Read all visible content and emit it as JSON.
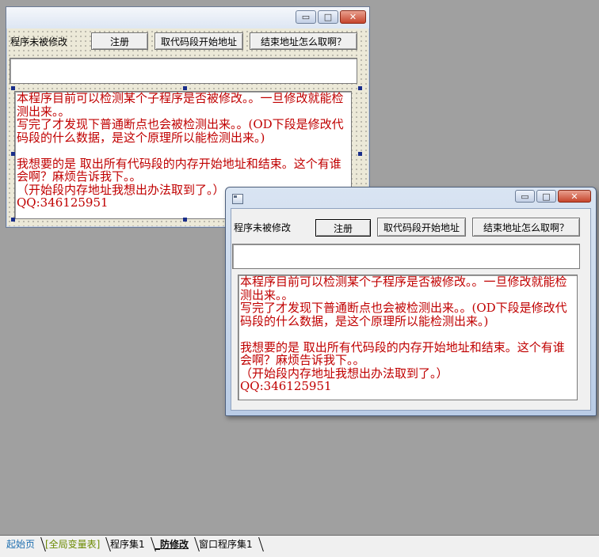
{
  "form": {
    "status_label": "程序未被修改",
    "register_button": "注册",
    "get_code_start_button": "取代码段开始地址",
    "get_end_button": "结束地址怎么取啊？",
    "memo_text": "本程序目前可以检测某个子程序是否被修改。。一旦修改就能检测出来。。\n写完了才发现下普通断点也会被检测出来。。(OD下段是修改代码段的什么数据，是这个原理所以能检测出来。)\n\n我想要的是 取出所有代码段的内存开始地址和结束。这个有谁会啊？麻烦告诉我下。。\n（开始段内存地址我想出办法取到了。）\nQQ:346125951"
  },
  "caption_buttons": {
    "minimize": "▭",
    "maximize": "□",
    "close": "✕"
  },
  "tabs": [
    {
      "label": "起始页",
      "style": "blue"
    },
    {
      "label": "[全局变量表]",
      "style": "green"
    },
    {
      "label": "程序集1",
      "style": "normal"
    },
    {
      "label": "_防修改",
      "style": "active"
    },
    {
      "label": "窗口程序集1",
      "style": "normal"
    }
  ],
  "colors": {
    "memo_text": "#c00000",
    "desktop": "#a0a0a0"
  }
}
